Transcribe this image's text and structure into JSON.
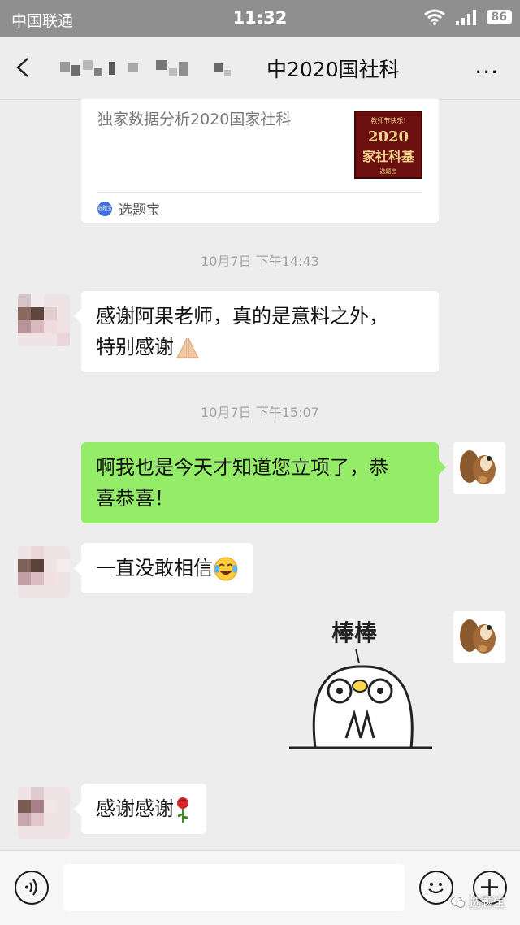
{
  "status_bar": {
    "carrier": "中国联通",
    "time": "11:32",
    "battery": "86"
  },
  "nav": {
    "title": "中2020国社科",
    "more": "···"
  },
  "card": {
    "title": "独家数据分析2020国家社科",
    "thumb_line1": "教师节快乐!",
    "thumb_line2": "2020",
    "thumb_line3": "家社科基",
    "thumb_line4": "选题宝",
    "source_logo": "选题宝",
    "source_name": "选题宝"
  },
  "messages": {
    "ts1": "10月7日 下午14:43",
    "msg1_line1": "感谢阿果老师，真的是意料之外，",
    "msg1_line2": "特别感谢",
    "ts2": "10月7日 下午15:07",
    "msg2_line1": "啊我也是今天才知道您立项了，恭",
    "msg2_line2": "喜恭喜！",
    "msg3": "一直没敢相信",
    "sticker_text": "棒棒",
    "msg4": "感谢感谢"
  },
  "watermark": "选题宝",
  "colors": {
    "status_bar": "#8f8f8f",
    "outgoing_bubble": "#95ec69",
    "incoming_bubble": "#ffffff",
    "background": "#ededed"
  },
  "icons": [
    "wifi-icon",
    "signal-icon",
    "back-icon",
    "voice-icon",
    "emoji-icon",
    "plus-icon",
    "pray-emoji",
    "laugh-cry-emoji",
    "rose-emoji"
  ]
}
